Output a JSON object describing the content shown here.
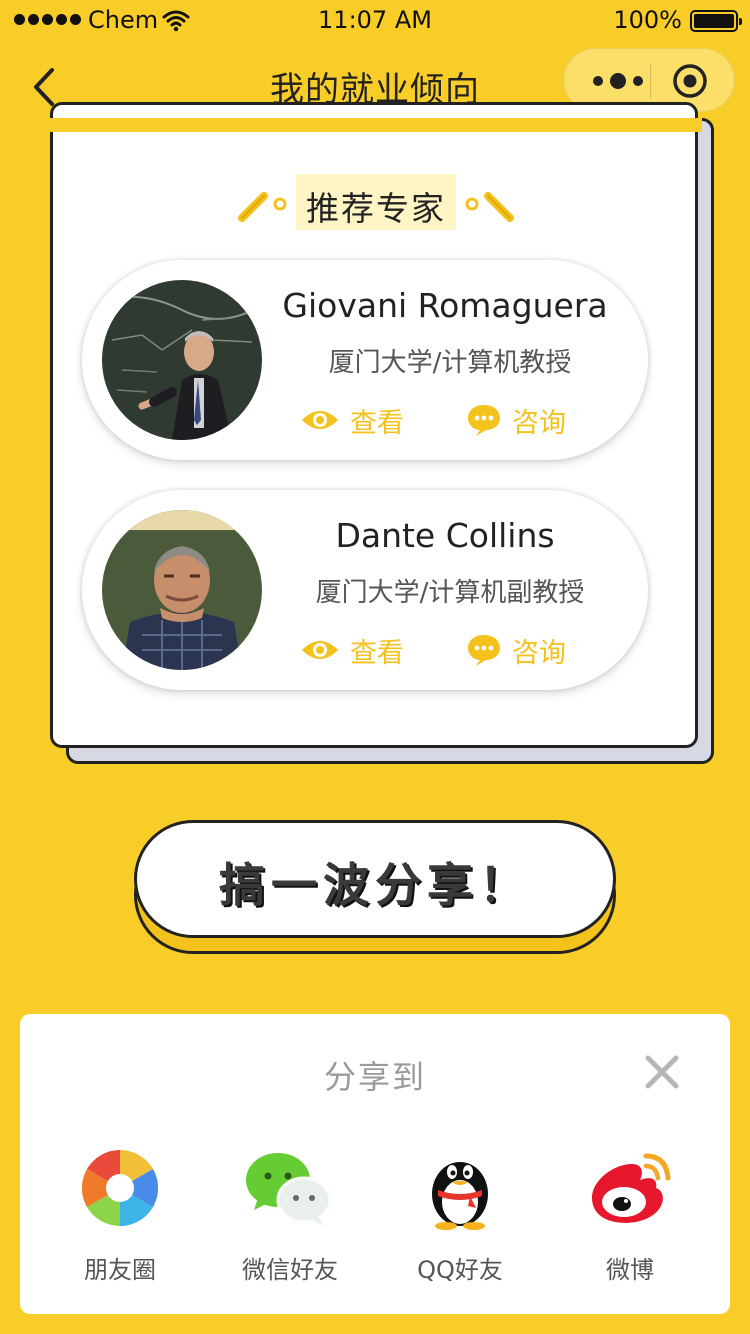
{
  "status_bar": {
    "carrier": "Chem",
    "time": "11:07 AM",
    "battery": "100%"
  },
  "nav": {
    "title": "我的就业倾向"
  },
  "recommend": {
    "title": "推荐专家",
    "experts": [
      {
        "name": "Giovani Romaguera",
        "title": "厦门大学/计算机教授",
        "view_label": "查看",
        "consult_label": "咨询"
      },
      {
        "name": "Dante Collins",
        "title": "厦门大学/计算机副教授",
        "view_label": "查看",
        "consult_label": "咨询"
      }
    ]
  },
  "share_button": {
    "label": "搞一波分享！"
  },
  "share_sheet": {
    "title": "分享到",
    "targets": [
      {
        "label": "朋友圈",
        "icon": "moments-icon"
      },
      {
        "label": "微信好友",
        "icon": "wechat-icon"
      },
      {
        "label": "QQ好友",
        "icon": "qq-icon"
      },
      {
        "label": "微博",
        "icon": "weibo-icon"
      }
    ]
  },
  "colors": {
    "background": "#F9CD28",
    "accent": "#F4C21C",
    "text": "#222222"
  }
}
